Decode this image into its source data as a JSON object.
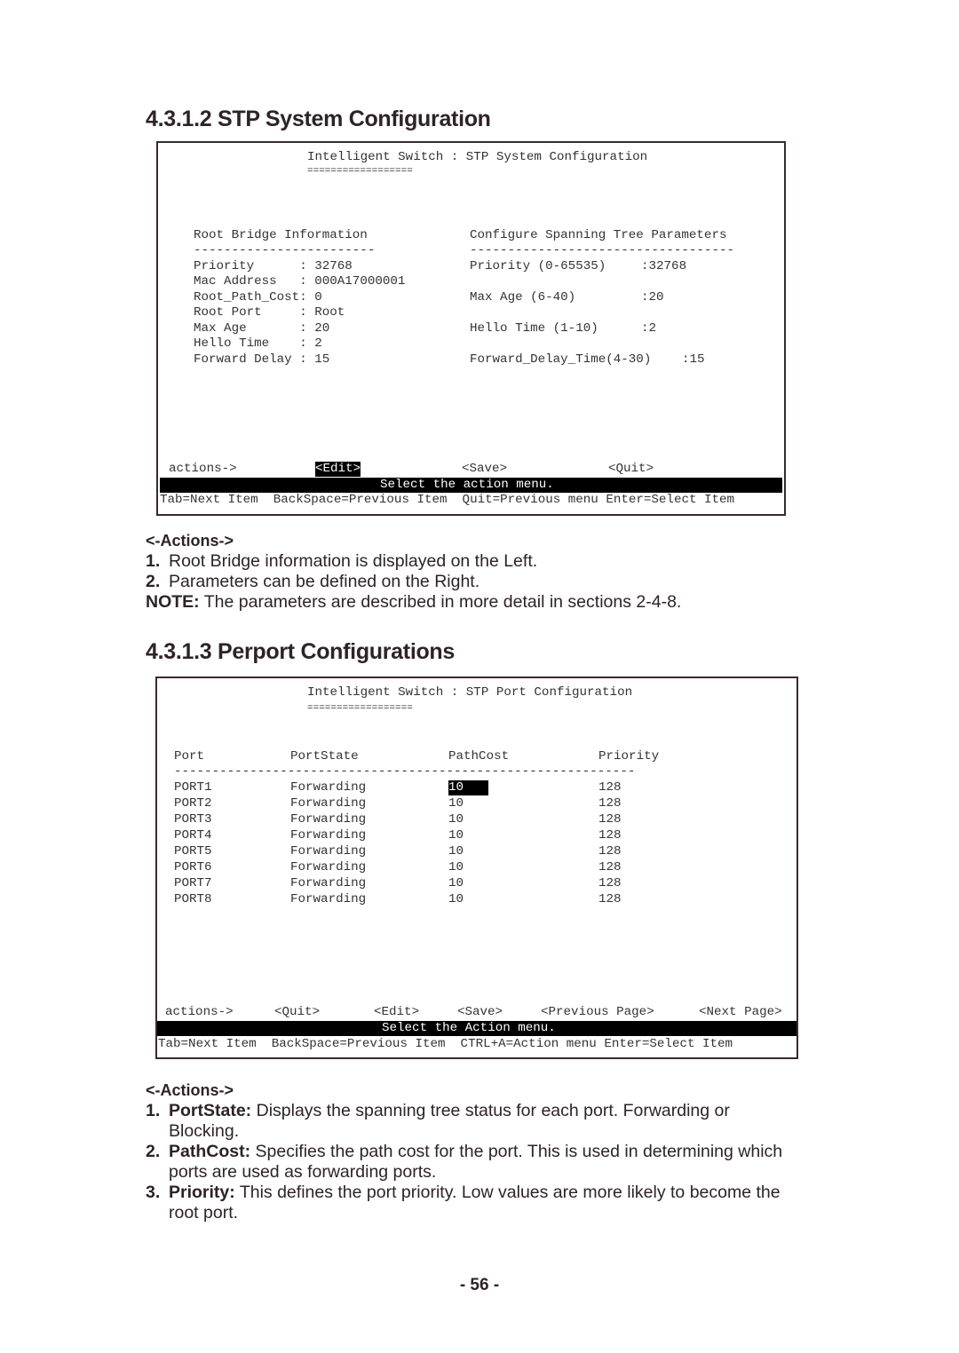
{
  "section1": {
    "heading": "4.3.1.2 STP System Configuration",
    "terminal": {
      "title": "Intelligent Switch : STP System Configuration",
      "title_underline": "==================",
      "left_header": "Root Bridge Information",
      "left_rule": "------------------------",
      "left_rows": [
        {
          "label": "Priority      ",
          "value": ": 32768"
        },
        {
          "label": "Mac Address   ",
          "value": ": 000A17000001"
        },
        {
          "label": "Root_Path_Cost",
          "value": ": 0"
        },
        {
          "label": "Root Port     ",
          "value": ": Root"
        },
        {
          "label": "Max Age       ",
          "value": ": 20"
        },
        {
          "label": "Hello Time    ",
          "value": ": 2"
        },
        {
          "label": "Forward Delay ",
          "value": ": 15"
        }
      ],
      "right_header": "Configure Spanning Tree Parameters",
      "right_rule": "-----------------------------------",
      "right_rows": [
        {
          "label": "Priority (0-65535)",
          "value": ":32768"
        },
        {
          "label": "Max Age (6-40)",
          "value": ":20"
        },
        {
          "label": "Hello Time (1-10)",
          "value": ":2"
        },
        {
          "label": "Forward_Delay_Time(4-30)",
          "value": ":15"
        }
      ],
      "actions_label": "actions->",
      "actions": [
        "<Edit>",
        "<Save>",
        "<Quit>"
      ],
      "selected_action": "<Edit>",
      "status": "Select the action menu.",
      "help": "Tab=Next Item  BackSpace=Previous Item  Quit=Previous menu Enter=Select Item"
    },
    "actions_title": "<-Actions->",
    "items": [
      {
        "num": "1.",
        "text": "Root Bridge information is displayed on the Left."
      },
      {
        "num": "2.",
        "text": "Parameters can be defined on the Right."
      }
    ],
    "note_label": "NOTE:",
    "note_text": " The parameters are described in more detail in sections 2-4-8."
  },
  "section2": {
    "heading": "4.3.1.3 Perport Configurations",
    "terminal": {
      "title": "Intelligent Switch : STP Port Configuration",
      "title_underline": "==================",
      "columns": [
        "Port",
        "PortState",
        "PathCost",
        "Priority"
      ],
      "rule": "-------------------------------------------------------------",
      "rows": [
        {
          "port": "PORT1",
          "state": "Forwarding",
          "cost": "10",
          "priority": "128"
        },
        {
          "port": "PORT2",
          "state": "Forwarding",
          "cost": "10",
          "priority": "128"
        },
        {
          "port": "PORT3",
          "state": "Forwarding",
          "cost": "10",
          "priority": "128"
        },
        {
          "port": "PORT4",
          "state": "Forwarding",
          "cost": "10",
          "priority": "128"
        },
        {
          "port": "PORT5",
          "state": "Forwarding",
          "cost": "10",
          "priority": "128"
        },
        {
          "port": "PORT6",
          "state": "Forwarding",
          "cost": "10",
          "priority": "128"
        },
        {
          "port": "PORT7",
          "state": "Forwarding",
          "cost": "10",
          "priority": "128"
        },
        {
          "port": "PORT8",
          "state": "Forwarding",
          "cost": "10",
          "priority": "128"
        }
      ],
      "actions_label": "actions->",
      "actions": [
        "<Quit>",
        "<Edit>",
        "<Save>",
        "<Previous Page>",
        "<Next Page>"
      ],
      "status": "Select the Action menu.",
      "help": "Tab=Next Item  BackSpace=Previous Item  CTRL+A=Action menu Enter=Select Item"
    },
    "actions_title": "<-Actions->",
    "items": [
      {
        "num": "1.",
        "term": "PortState:",
        "text": " Displays the spanning tree status for each port. Forwarding or",
        "cont": "Blocking."
      },
      {
        "num": "2.",
        "term": "PathCost:",
        "text": " Specifies the path cost for the port. This is used in determining which",
        "cont": "ports are used as forwarding ports."
      },
      {
        "num": "3.",
        "term": "Priority:",
        "text": " This defines the port priority. Low values are more likely to become the",
        "cont": "root port."
      }
    ]
  },
  "page_number": "- 56 -"
}
